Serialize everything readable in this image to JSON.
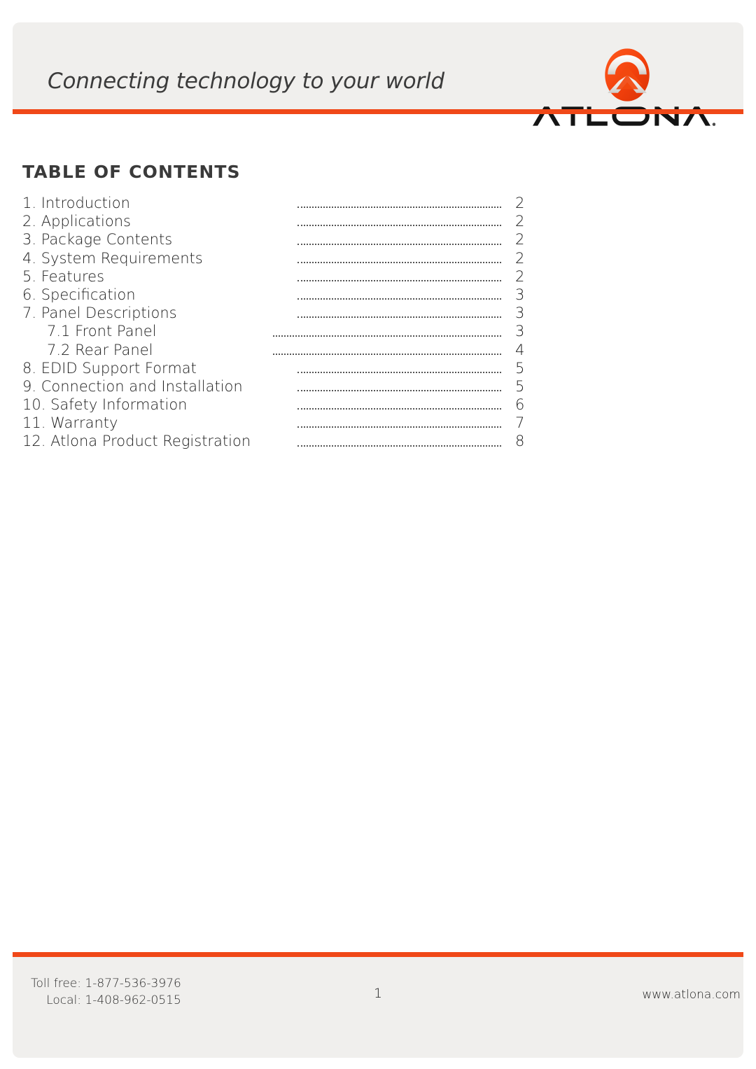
{
  "header": {
    "tagline": "Connecting technology to your world",
    "brand_name": "ATLONA",
    "logo_icon": "atlona-chevron-logo-icon",
    "accent_color": "#f04818",
    "panel_color": "#f0efed"
  },
  "document": {
    "heading": "TABLE OF CONTENTS",
    "entries": [
      {
        "label": "1. Introduction",
        "page": "2",
        "sub": false
      },
      {
        "label": "2. Applications",
        "page": "2",
        "sub": false
      },
      {
        "label": "3. Package Contents",
        "page": "2",
        "sub": false
      },
      {
        "label": "4. System Requirements",
        "page": "2",
        "sub": false
      },
      {
        "label": "5. Features",
        "page": "2",
        "sub": false
      },
      {
        "label": "6. Specification",
        "page": "3",
        "sub": false
      },
      {
        "label": "7. Panel Descriptions",
        "page": "3",
        "sub": false
      },
      {
        "label": "7.1 Front Panel",
        "page": "3",
        "sub": true
      },
      {
        "label": "7.2 Rear Panel",
        "page": "4",
        "sub": true
      },
      {
        "label": "8. EDID Support Format",
        "page": "5",
        "sub": false
      },
      {
        "label": "9. Connection and Installation",
        "page": "5",
        "sub": false
      },
      {
        "label": "10. Safety Information",
        "page": "6",
        "sub": false
      },
      {
        "label": "11. Warranty",
        "page": "7",
        "sub": false
      },
      {
        "label": "12. Atlona Product Registration",
        "page": "8",
        "sub": false
      }
    ]
  },
  "footer": {
    "toll_free": "Toll free: 1-877-536-3976",
    "local": "Local: 1-408-962-0515",
    "page_number": "1",
    "website": "www.atlona.com"
  }
}
